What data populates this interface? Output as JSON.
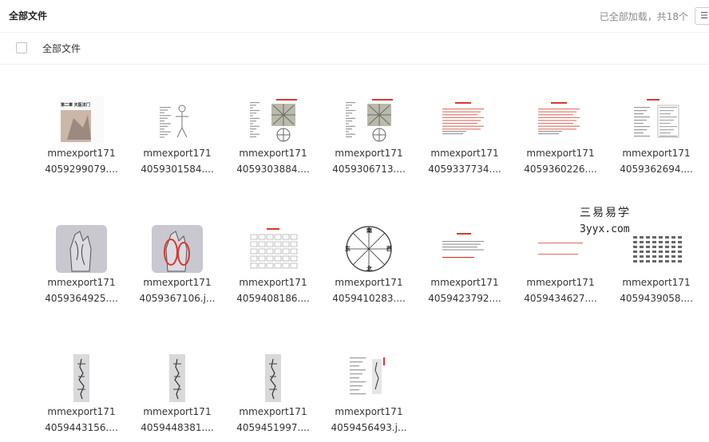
{
  "header": {
    "title": "全部文件",
    "status": "已全部加载，共18个",
    "menu_icon": "list-menu-icon"
  },
  "subheader": {
    "label": "全部文件"
  },
  "files": [
    {
      "line1": "mmexport171",
      "line2": "4059299079....",
      "thumb": "doc-cover",
      "thumb_text": "第二章 天医法门"
    },
    {
      "line1": "mmexport171",
      "line2": "4059301584....",
      "thumb": "figure-doc"
    },
    {
      "line1": "mmexport171",
      "line2": "4059303884....",
      "thumb": "compass-doc"
    },
    {
      "line1": "mmexport171",
      "line2": "4059306713....",
      "thumb": "compass-doc"
    },
    {
      "line1": "mmexport171",
      "line2": "4059337734....",
      "thumb": "red-text-doc"
    },
    {
      "line1": "mmexport171",
      "line2": "4059360226....",
      "thumb": "red-text-doc"
    },
    {
      "line1": "mmexport171",
      "line2": "4059362694....",
      "thumb": "table-doc"
    },
    {
      "line1": "mmexport171",
      "line2": "4059364925....",
      "thumb": "hand-photo"
    },
    {
      "line1": "mmexport171",
      "line2": "4059367106.j...",
      "thumb": "hand-photo-red"
    },
    {
      "line1": "mmexport171",
      "line2": "4059408186....",
      "thumb": "grid-doc"
    },
    {
      "line1": "mmexport171",
      "line2": "4059410283....",
      "thumb": "compass-wheel",
      "compass": {
        "n": "南",
        "s": "北",
        "e": "东",
        "w": "西"
      }
    },
    {
      "line1": "mmexport171",
      "line2": "4059423792....",
      "thumb": "text-doc"
    },
    {
      "line1": "mmexport171",
      "line2": "4059434627....",
      "thumb": "sparse-doc"
    },
    {
      "line1": "mmexport171",
      "line2": "4059439058....",
      "thumb": "column-text"
    },
    {
      "line1": "mmexport171",
      "line2": "4059443156....",
      "thumb": "talisman"
    },
    {
      "line1": "mmexport171",
      "line2": "4059448381....",
      "thumb": "talisman"
    },
    {
      "line1": "mmexport171",
      "line2": "4059451997....",
      "thumb": "talisman"
    },
    {
      "line1": "mmexport171",
      "line2": "4059456493.j...",
      "thumb": "talisman-doc"
    }
  ],
  "watermark": {
    "line1": "三易易学",
    "line2": "3yyx.com"
  },
  "colors": {
    "accent_red": "#d9392f",
    "border": "#eef0f3",
    "text": "#333333",
    "muted": "#8a8a8a"
  }
}
